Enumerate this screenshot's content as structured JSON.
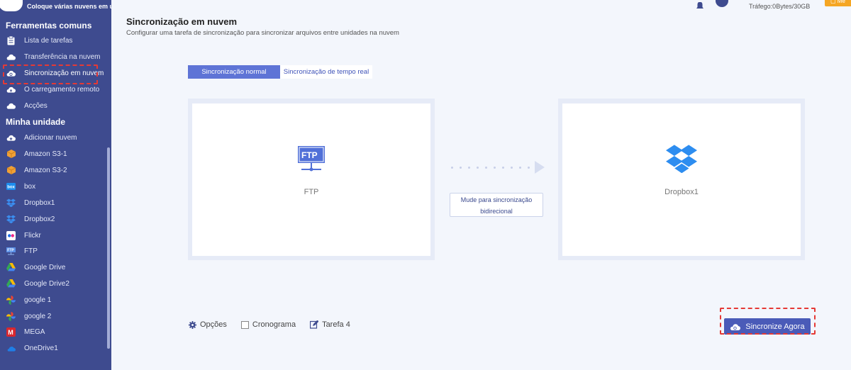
{
  "brand": {
    "tagline": "Coloque várias nuvens em uma"
  },
  "sidebar": {
    "section_tools": "Ferramentas comuns",
    "tools": [
      {
        "label": "Lista de tarefas",
        "icon": "clipboard-icon"
      },
      {
        "label": "Transferência na nuvem",
        "icon": "cloud-transfer-icon"
      },
      {
        "label": "Sincronização em nuvem",
        "icon": "cloud-sync-icon"
      },
      {
        "label": "O carregamento remoto",
        "icon": "cloud-upload-icon"
      },
      {
        "label": "Acções",
        "icon": "cloud-share-icon"
      }
    ],
    "section_drives": "Minha unidade",
    "drives": [
      {
        "label": "Adicionar nuvem",
        "icon": "cloud-add-icon"
      },
      {
        "label": "Amazon S3-1",
        "icon": "amazon-s3-icon"
      },
      {
        "label": "Amazon S3-2",
        "icon": "amazon-s3-icon"
      },
      {
        "label": "box",
        "icon": "box-icon"
      },
      {
        "label": "Dropbox1",
        "icon": "dropbox-icon"
      },
      {
        "label": "Dropbox2",
        "icon": "dropbox-icon"
      },
      {
        "label": "Flickr",
        "icon": "flickr-icon"
      },
      {
        "label": "FTP",
        "icon": "ftp-icon"
      },
      {
        "label": "Google Drive",
        "icon": "google-drive-icon"
      },
      {
        "label": "Google Drive2",
        "icon": "google-drive-icon"
      },
      {
        "label": "google 1",
        "icon": "google-photos-icon"
      },
      {
        "label": "google 2",
        "icon": "google-photos-icon"
      },
      {
        "label": "MEGA",
        "icon": "mega-icon"
      },
      {
        "label": "OneDrive1",
        "icon": "onedrive-icon"
      }
    ]
  },
  "topbar": {
    "traffic": "Tráfego:0Bytes/30GB",
    "button_label": "Me"
  },
  "main": {
    "title": "Sincronização em nuvem",
    "subtitle": "Configurar uma tarefa de sincronização para sincronizar arquivos entre unidades na nuvem",
    "tabs": [
      {
        "label": "Sincronização normal",
        "active": true
      },
      {
        "label": "Sincronização de tempo real",
        "active": false
      }
    ],
    "source": {
      "label": "FTP",
      "icon": "ftp-icon"
    },
    "target": {
      "label": "Dropbox1",
      "icon": "dropbox-icon"
    },
    "mode_button": {
      "line1": "Mude para sincronização",
      "line2": "bidirecional"
    },
    "options": {
      "options_label": "Opções",
      "schedule_label": "Cronograma",
      "task_label": "Tarefa 4"
    },
    "sync_button": "Sincronize Agora"
  },
  "colors": {
    "sidebar_bg": "#3e4b8f",
    "accent": "#5e74d6",
    "primary_button": "#4a5bb8",
    "highlight": "#e53935"
  }
}
